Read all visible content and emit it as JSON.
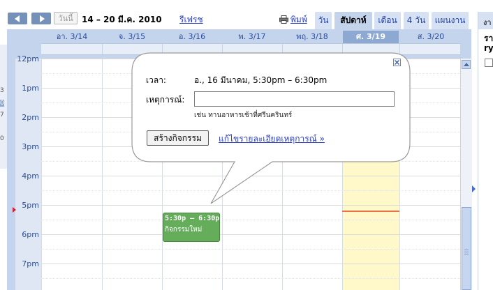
{
  "toolbar": {
    "today_label": "วันนี้",
    "date_range": "14 – 20 มี.ค. 2010",
    "refresh_label": "รีเฟรช",
    "print_label": "พิมพ์",
    "views": [
      "วัน",
      "สัปดาห์",
      "เดือน",
      "4 วัน",
      "แผนงาน"
    ],
    "active_view": "สัปดาห์"
  },
  "days": [
    {
      "label": "อา. 3/14"
    },
    {
      "label": "จ. 3/15"
    },
    {
      "label": "อ. 3/16"
    },
    {
      "label": "พ. 3/17"
    },
    {
      "label": "พฤ. 3/18"
    },
    {
      "label": "ศ. 3/19",
      "today": true
    },
    {
      "label": "ส. 3/20"
    }
  ],
  "hours": [
    "12pm",
    "1pm",
    "2pm",
    "3pm",
    "4pm",
    "5pm",
    "6pm",
    "7pm"
  ],
  "left_mini": [
    "3",
    "0",
    "7",
    "0"
  ],
  "right_panel": {
    "tab": "งา",
    "line1": "รา",
    "line2": "ry"
  },
  "event": {
    "time": "5:30p – 6:30p",
    "title": "กิจกรรมใหม่",
    "color": "#65ad5b"
  },
  "popup": {
    "when_label": "เวลา:",
    "when_value": "อ., 16 มีนาคม, 5:30pm – 6:30pm",
    "what_label": "เหตุการณ์:",
    "what_value": "",
    "hint": "เช่น ทานอาหารเช้าที่ศรีนครินทร์",
    "create_label": "สร้างกิจกรรม",
    "edit_label": "แก้ไขรายละเอียดเหตุการณ์ »"
  },
  "colors": {
    "header_blue": "#c4d4ec",
    "today_column": "#fff9c9",
    "link": "#2a3ec4",
    "now_line": "#e8734d"
  }
}
